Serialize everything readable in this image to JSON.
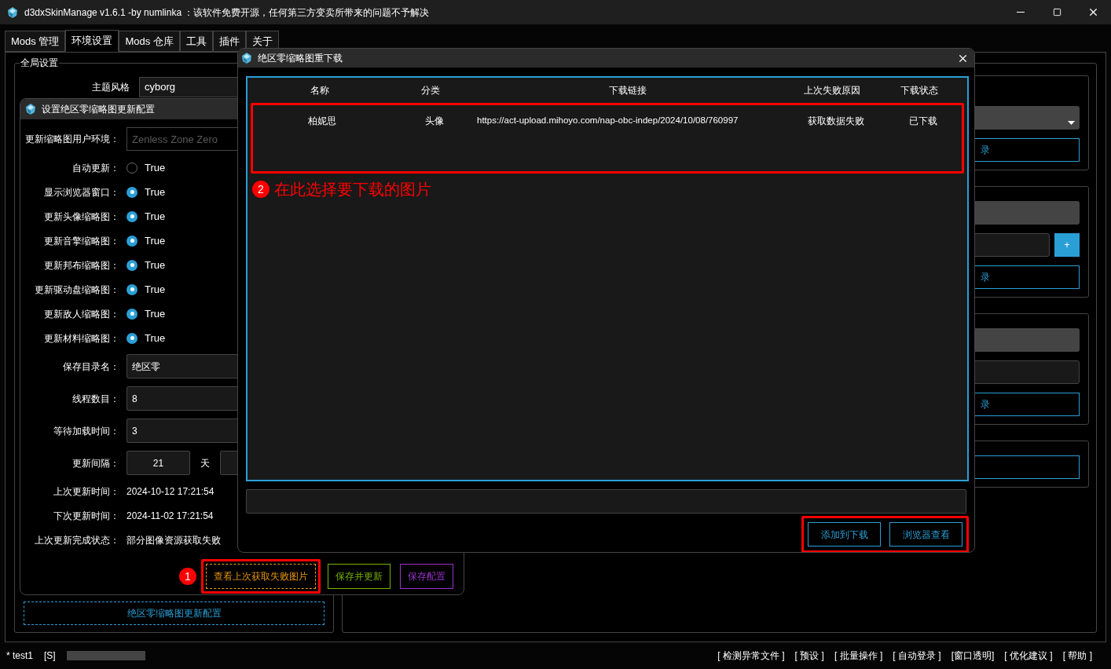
{
  "window": {
    "title": "d3dxSkinManage v1.6.1 -by numlinka ：该软件免费开源，任何第三方变卖所带来的问题不予解决"
  },
  "tabs": [
    {
      "label": "Mods 管理",
      "selected": false
    },
    {
      "label": "环境设置",
      "selected": true
    },
    {
      "label": "Mods 仓库",
      "selected": false
    },
    {
      "label": "工具",
      "selected": false
    },
    {
      "label": "插件",
      "selected": false
    },
    {
      "label": "关于",
      "selected": false
    }
  ],
  "global_settings": {
    "title": "全局设置",
    "theme_label": "主题风格",
    "theme_value": "cyborg",
    "config_button": "绝区零缩略图更新配置"
  },
  "right_panel": {
    "groups": [
      {
        "kind": "dropdown",
        "button": "录"
      },
      {
        "kind": "add",
        "plus": "+",
        "button": "录"
      },
      {
        "kind": "input",
        "button": "录"
      },
      {
        "kind": "button"
      }
    ]
  },
  "settings_dialog": {
    "title": "设置绝区零缩略图更新配置",
    "env_label": "更新缩略图用户环境：",
    "env_placeholder": "Zenless Zone Zero",
    "toggles": [
      {
        "label": "自动更新：",
        "text": "True",
        "checked": false
      },
      {
        "label": "显示浏览器窗口：",
        "text": "True",
        "checked": true
      },
      {
        "label": "更新头像缩略图：",
        "text": "True",
        "checked": true
      },
      {
        "label": "更新音擎缩略图：",
        "text": "True",
        "checked": true
      },
      {
        "label": "更新邦布缩略图：",
        "text": "True",
        "checked": true
      },
      {
        "label": "更新驱动盘缩略图：",
        "text": "True",
        "checked": true
      },
      {
        "label": "更新敌人缩略图：",
        "text": "True",
        "checked": true
      },
      {
        "label": "更新材料缩略图：",
        "text": "True",
        "checked": true
      }
    ],
    "fields": [
      {
        "label": "保存目录名：",
        "value": "绝区零"
      },
      {
        "label": "线程数目：",
        "value": "8"
      },
      {
        "label": "等待加载时间：",
        "value": "3"
      }
    ],
    "interval": {
      "label": "更新间隔：",
      "value": "21",
      "unit": "天"
    },
    "info": [
      {
        "label": "上次更新时间：",
        "value": "2024-10-12 17:21:54"
      },
      {
        "label": "下次更新时间：",
        "value": "2024-11-02 17:21:54"
      },
      {
        "label": "上次更新完成状态：",
        "value": "部分图像资源获取失败"
      }
    ],
    "buttons": [
      {
        "label": "查看上次获取失败图片",
        "color": "#e8950c",
        "highlighted": true,
        "marker": "1"
      },
      {
        "label": "保存并更新",
        "color": "#77b300",
        "highlighted": false
      },
      {
        "label": "保存配置",
        "color": "#9933cc",
        "highlighted": false
      }
    ]
  },
  "download_dialog": {
    "title": "绝区零缩略图重下载",
    "columns": [
      "名称",
      "分类",
      "下载链接",
      "上次失败原因",
      "下载状态"
    ],
    "rows": [
      {
        "cells": [
          "柏妮思",
          "头像",
          "https://act-upload.mihoyo.com/nap-obc-indep/2024/10/08/760997",
          "获取数据失败",
          "已下载"
        ],
        "highlighted": true
      }
    ],
    "callout": {
      "number": "2",
      "text": "在此选择要下载的图片"
    },
    "buttons": [
      "添加到下载",
      "浏览器查看"
    ],
    "buttons_highlighted": true
  },
  "status_bar": {
    "profile": "* test1",
    "mode": "[S]",
    "links": [
      "[ 检测异常文件 ]",
      "[ 预设 ]",
      "[ 批量操作 ]",
      "[ 自动登录 ]",
      "[窗口透明]",
      "[ 优化建议 ]",
      "[ 帮助 ]"
    ]
  }
}
